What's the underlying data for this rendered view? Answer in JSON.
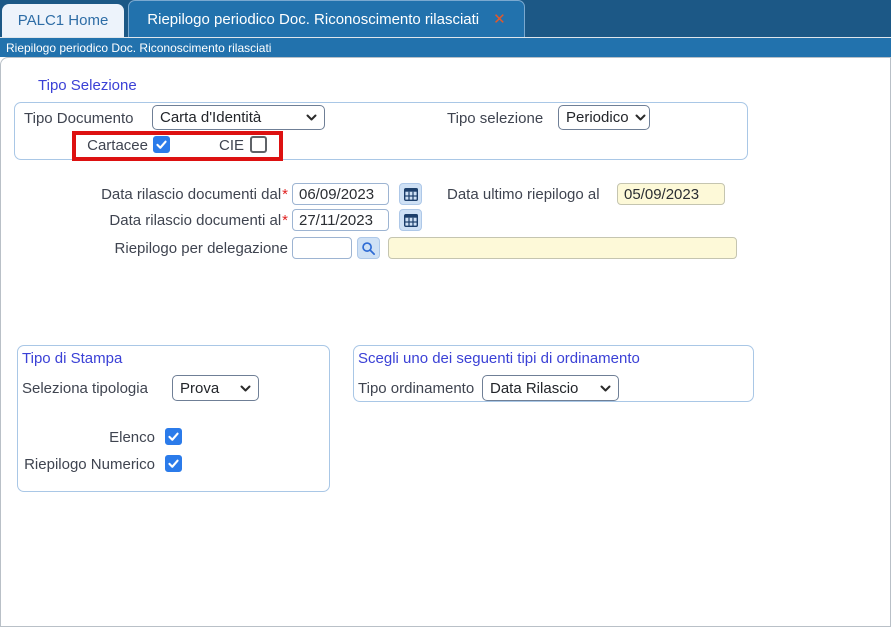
{
  "tabs": {
    "home": {
      "label": "PALC1 Home"
    },
    "active": {
      "label": "Riepilogo periodico Doc. Riconoscimento rilasciati",
      "close_glyph": "✕"
    }
  },
  "breadcrumb": {
    "title": "Riepilogo periodico Doc. Riconoscimento rilasciati"
  },
  "selection": {
    "section_title": "Tipo Selezione",
    "tipo_documento": {
      "label": "Tipo Documento",
      "value": "Carta d'Identità"
    },
    "tipo_selezione": {
      "label": "Tipo selezione",
      "value": "Periodico"
    },
    "cartacee": {
      "label": "Cartacee",
      "checked": true
    },
    "cie": {
      "label": "CIE",
      "checked": false
    }
  },
  "dates": {
    "dal": {
      "label": "Data rilascio documenti dal",
      "required_mark": "*",
      "value": "06/09/2023"
    },
    "al": {
      "label": "Data rilascio documenti al",
      "required_mark": "*",
      "value": "27/11/2023"
    },
    "ultimo": {
      "label": "Data ultimo riepilogo al",
      "value": "05/09/2023"
    },
    "delegazione": {
      "label": "Riepilogo per delegazione",
      "code_value": "",
      "desc_value": ""
    }
  },
  "stampa": {
    "section_title": "Tipo di Stampa",
    "tipologia": {
      "label": "Seleziona tipologia",
      "value": "Prova"
    },
    "elenco": {
      "label": "Elenco",
      "checked": true
    },
    "riepilogo_numerico": {
      "label": "Riepilogo Numerico",
      "checked": true
    }
  },
  "ordinamento": {
    "section_title": "Scegli uno dei seguenti tipi di ordinamento",
    "tipo": {
      "label": "Tipo ordinamento",
      "value": "Data Rilascio"
    }
  },
  "colors": {
    "tab_bar_background": "#1c5886",
    "active_tab_blue": "#2272ad",
    "section_title_blue": "#3b41d6",
    "checkbox_checked_blue": "#2b7bea",
    "readonly_field_yellow": "#fdf9d8",
    "highlight_box_red": "#dd1111",
    "required_asterisk_red": "#e02020",
    "close_icon_orange": "#e2592b"
  }
}
